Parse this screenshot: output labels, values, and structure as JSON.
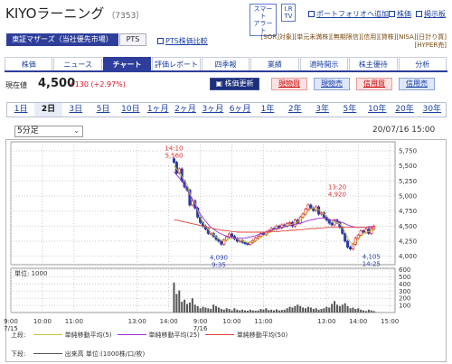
{
  "header": {
    "company": "KIYOラーニング",
    "code": "（7353）",
    "smart_alert": [
      "スマート",
      "アラート"
    ],
    "ir_tv": [
      "I.R",
      "TV"
    ],
    "add_portfolio": "ポートフォリオへ追加",
    "stock_price": "株価",
    "bulletin": "掲示板"
  },
  "market": {
    "main": "東証マザーズ（当社優先市場）",
    "pts": "PTS",
    "pts_price_link": "PTS株価比較",
    "services_row1": "[SOR]対象][単元未満株][無期限信][信用][貸株][NISA][日計り買]",
    "services_row2": "[HYPER売]"
  },
  "tabs": [
    {
      "label": "株価",
      "active": false
    },
    {
      "label": "ニュース",
      "active": false
    },
    {
      "label": "チャート",
      "active": true
    },
    {
      "label": "評価レポート",
      "active": false
    },
    {
      "label": "四季報",
      "active": false
    },
    {
      "label": "業績",
      "active": false
    },
    {
      "label": "適時開示",
      "active": false
    },
    {
      "label": "株主優待",
      "active": false
    },
    {
      "label": "分析",
      "active": false
    }
  ],
  "quote": {
    "current_label": "現在値",
    "price": "4,500",
    "change": "+130 (+2.97%)",
    "update_button": "株価更新",
    "buy_spot": "現物買",
    "sell_spot": "現物売",
    "buy_margin": "信用買",
    "sell_margin": "信用売"
  },
  "periods": [
    {
      "label": "1日",
      "active": false
    },
    {
      "label": "2日",
      "active": true
    },
    {
      "label": "3日",
      "active": false
    },
    {
      "label": "5日",
      "active": false
    },
    {
      "label": "10日",
      "active": false
    },
    {
      "label": "1ヶ月",
      "active": false
    },
    {
      "label": "2ヶ月",
      "active": false
    },
    {
      "label": "3ヶ月",
      "active": false
    },
    {
      "label": "6ヶ月",
      "active": false
    },
    {
      "label": "1年",
      "active": false
    },
    {
      "label": "2年",
      "active": false
    },
    {
      "label": "3年",
      "active": false
    },
    {
      "label": "5年",
      "active": false
    },
    {
      "label": "10年",
      "active": false
    },
    {
      "label": "20年",
      "active": false
    },
    {
      "label": "30年",
      "active": false
    }
  ],
  "interval": {
    "selected": "5分足"
  },
  "as_of": "20/07/16 15:00",
  "chart_data": {
    "type": "candlestick",
    "ylim": [
      3860,
      5900
    ],
    "price_ticks": [
      4000,
      4250,
      4500,
      4750,
      5000,
      5250,
      5500,
      5750
    ],
    "price_tick_labels": [
      "4,000",
      "4,250",
      "4,500",
      "4,750",
      "5,000",
      "5,250",
      "5,500",
      "5,750"
    ],
    "volume_unit": "単位: 1000",
    "volume_ylim": [
      0,
      620
    ],
    "volume_ticks": [
      100,
      200,
      300,
      400,
      500,
      600
    ],
    "x_tick_labels": [
      "9:00",
      "10:00",
      "11:00",
      "13:00",
      "14:00",
      "9:00",
      "10:00",
      "11:00",
      "13:00",
      "14:00",
      "15:00"
    ],
    "x_tick_times": [
      0,
      12,
      24,
      48,
      60,
      72,
      84,
      96,
      120,
      132,
      144
    ],
    "date_labels": [
      {
        "label": "7/15",
        "t": 0
      },
      {
        "label": "7/16",
        "t": 72
      }
    ],
    "annotations": [
      {
        "time": "14:10",
        "price": "5,560",
        "t": 62,
        "value": 5560,
        "pos": "above"
      },
      {
        "time": "9:35",
        "price": "4,090",
        "t": 79,
        "value": 4090,
        "pos": "below"
      },
      {
        "time": "13:20",
        "price": "4,920",
        "t": 124,
        "value": 4920,
        "pos": "above"
      },
      {
        "time": "14:25",
        "price": "4,105",
        "t": 137,
        "value": 4105,
        "pos": "below"
      }
    ],
    "closes": [
      5560,
      5380,
      5450,
      5250,
      5150,
      5100,
      4850,
      4920,
      4800,
      4650,
      4560,
      4500,
      4450,
      4380,
      4380,
      4330,
      4280,
      4250,
      4200,
      4270,
      4320,
      4370,
      4330,
      4290,
      4250,
      4260,
      4230,
      4210,
      4200,
      4230,
      4260,
      4300,
      4330,
      4380,
      4360,
      4400,
      4420,
      4460,
      4450,
      4500,
      4470,
      4520,
      4500,
      4540,
      4560,
      4500,
      4600,
      4550,
      4650,
      4700,
      4780,
      4850,
      4800,
      4760,
      4820,
      4700,
      4720,
      4650,
      4600,
      4550,
      4520,
      4600,
      4560,
      4480,
      4380,
      4250,
      4150,
      4120,
      4200,
      4300,
      4350,
      4420,
      4400,
      4450,
      4380,
      4450,
      4500
    ],
    "close_times": [
      62,
      63,
      64,
      65,
      66,
      67,
      68,
      69,
      70,
      71,
      72,
      73,
      74,
      75,
      76,
      77,
      78,
      79,
      80,
      81,
      82,
      83,
      84,
      85,
      86,
      87,
      88,
      89,
      90,
      91,
      92,
      93,
      94,
      95,
      96,
      97,
      98,
      99,
      100,
      101,
      102,
      103,
      104,
      105,
      106,
      107,
      108,
      109,
      110,
      111,
      112,
      113,
      114,
      115,
      116,
      117,
      118,
      119,
      120,
      121,
      122,
      123,
      124,
      125,
      126,
      127,
      128,
      129,
      130,
      131,
      132,
      133,
      134,
      135,
      136,
      137,
      138
    ],
    "volumes": [
      420,
      260,
      310,
      150,
      180,
      120,
      140,
      200,
      110,
      90,
      60,
      80,
      70,
      60,
      50,
      110,
      90,
      70,
      50,
      40,
      60,
      50,
      30,
      60,
      40,
      30,
      40,
      30,
      25,
      40,
      30,
      25,
      30,
      50,
      40,
      60,
      35,
      40,
      30,
      45,
      30,
      35,
      40,
      60,
      80,
      70,
      90,
      110,
      90,
      70,
      60,
      80,
      70,
      50,
      60,
      40,
      50,
      60,
      80,
      70,
      120,
      160,
      110,
      90,
      110,
      130,
      90,
      60,
      70,
      50,
      60,
      40,
      30,
      20,
      40,
      30,
      20
    ],
    "ma5": [
      5500,
      5450,
      5400,
      5330,
      5250,
      5190,
      5050,
      4960,
      4890,
      4760,
      4650,
      4560,
      4500,
      4450,
      4400,
      4360,
      4320,
      4290,
      4260,
      4260,
      4270,
      4290,
      4300,
      4300,
      4290,
      4270,
      4250,
      4240,
      4230,
      4230,
      4240,
      4260,
      4280,
      4310,
      4340,
      4370,
      4390,
      4410,
      4440,
      4460,
      4470,
      4490,
      4500,
      4510,
      4520,
      4530,
      4550,
      4570,
      4600,
      4650,
      4700,
      4740,
      4780,
      4800,
      4790,
      4770,
      4740,
      4700,
      4660,
      4620,
      4590,
      4580,
      4560,
      4540,
      4480,
      4400,
      4310,
      4230,
      4200,
      4230,
      4270,
      4330,
      4370,
      4400,
      4410,
      4420,
      4440
    ],
    "ma25": [
      5400,
      5350,
      5300,
      5240,
      5180,
      5100,
      5020,
      4940,
      4860,
      4780,
      4700,
      4640,
      4580,
      4530,
      4480,
      4450,
      4420,
      4390,
      4370,
      4350,
      4330,
      4320,
      4310,
      4300,
      4300,
      4300,
      4300,
      4300,
      4310,
      4320,
      4330,
      4340,
      4360,
      4370,
      4390,
      4400,
      4420,
      4430,
      4450,
      4460,
      4470,
      4480,
      4490,
      4500,
      4510,
      4520,
      4530,
      4540,
      4550,
      4560,
      4580,
      4590,
      4600,
      4610,
      4620,
      4630,
      4630,
      4630,
      4620,
      4610,
      4600,
      4590,
      4580,
      4570,
      4560,
      4540,
      4520,
      4500,
      4490,
      4480,
      4480,
      4480,
      4480,
      4480,
      4490,
      4490,
      4490
    ],
    "ma50": [
      4600,
      4600,
      4590,
      4580,
      4570,
      4560,
      4550,
      4540,
      4530,
      4520,
      4510,
      4500,
      4490,
      4480,
      4470,
      4460,
      4450,
      4440,
      4430,
      4430,
      4420,
      4420,
      4410,
      4410,
      4400,
      4400,
      4400,
      4400,
      4400,
      4400,
      4400,
      4400,
      4400,
      4400,
      4400,
      4400,
      4400,
      4410,
      4410,
      4410,
      4410,
      4420,
      4420,
      4420,
      4430,
      4430,
      4430,
      4440,
      4440,
      4440,
      4450,
      4450,
      4460,
      4460,
      4460,
      4470,
      4470,
      4470,
      4480,
      4480,
      4480,
      4480,
      4480,
      4480,
      4480,
      4480,
      4480,
      4480,
      4480,
      4480,
      4480,
      4480,
      4480,
      4480,
      4480,
      4480,
      4480
    ],
    "legend_upper_label": "上段:",
    "legend_upper": [
      {
        "name": "単純移動平均(5)",
        "color": "#c9c23a"
      },
      {
        "name": "単純移動平均(25)",
        "color": "#9b2fd0"
      },
      {
        "name": "単純移動平均(50)",
        "color": "#e0463a"
      }
    ],
    "legend_lower_label": "下段:",
    "legend_lower": [
      {
        "name": "出来高 単位:(1000株/口/枚)",
        "color": "#555555"
      }
    ],
    "colors": {
      "up": "#d83030",
      "down": "#2a3ea6",
      "annot_high": "#d83030",
      "annot_low": "#2a3ea6",
      "grid": "#cccccc"
    }
  }
}
